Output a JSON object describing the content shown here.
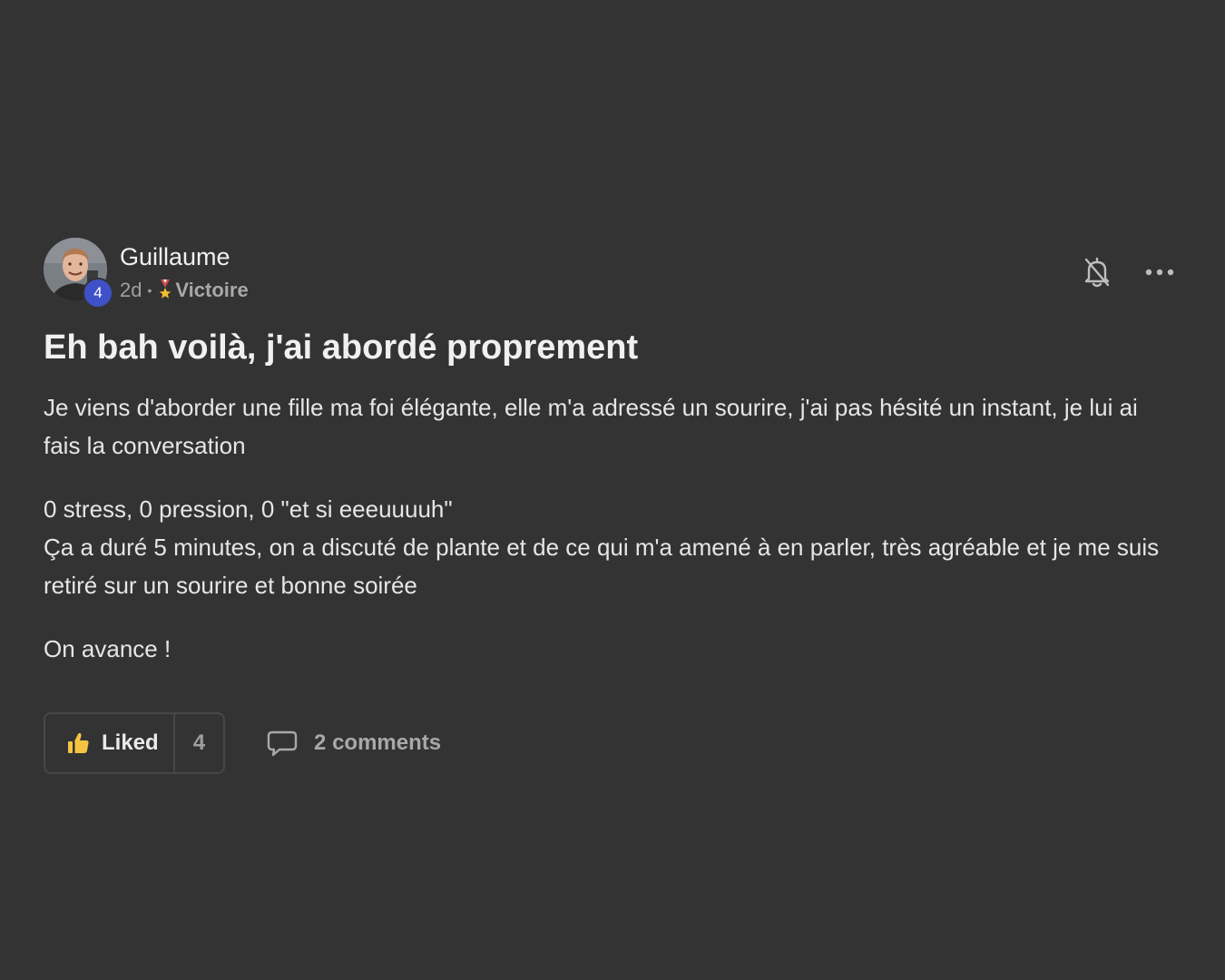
{
  "post": {
    "author": {
      "name": "Guillaume",
      "level": "4",
      "avatar": "profile-photo"
    },
    "time_ago": "2d",
    "separator": "•",
    "category": "Victoire",
    "category_icon": "medal-icon",
    "title": "Eh bah voilà, j'ai abordé proprement",
    "paragraphs": [
      "Je viens d'aborder une fille ma foi élégante, elle m'a adressé un sourire, j'ai pas hésité un instant, je lui ai fais la conversation",
      "0 stress, 0 pression, 0 \"et si eeeuuuuh\"",
      "Ça a duré 5 minutes, on a discuté de plante et de ce qui m'a amené à en parler, très agréable et je me suis retiré sur un sourire et bonne soirée",
      "On avance !"
    ]
  },
  "header_actions": {
    "notifications_icon": "bell-off-icon",
    "more_icon": "more-horizontal-icon"
  },
  "actions": {
    "like_label": "Liked",
    "like_count": "4",
    "like_icon": "thumbs-up-icon",
    "comments_label": "2 comments",
    "comments_icon": "comment-icon"
  },
  "colors": {
    "background": "#333333",
    "text": "#e6e6e6",
    "muted": "#a0a0a0",
    "level_badge": "#3f51c8",
    "like_icon": "#f5c542"
  }
}
